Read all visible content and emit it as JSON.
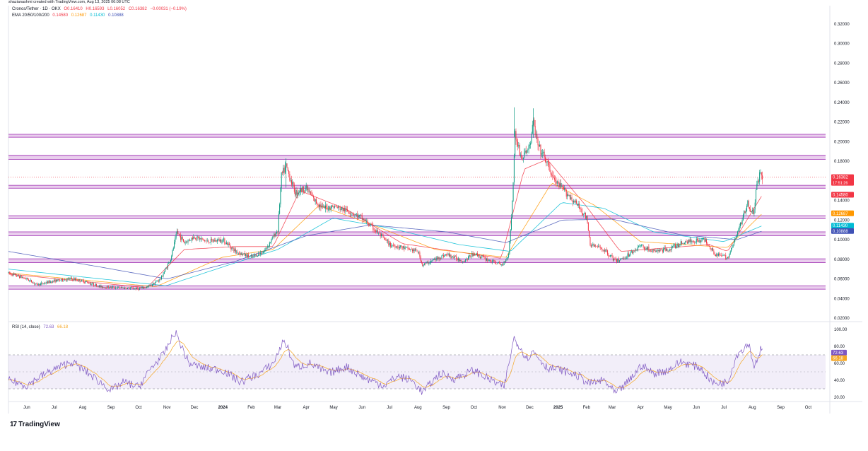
{
  "header": {
    "credit": "shazianashmi created with TradingView.com, Aug 13, 2025 06:08 UTC",
    "symbol": "Cronos/Tether · 1D · OKX",
    "o": "O0.16410",
    "h": "H0.16593",
    "l": "L0.16052",
    "c": "C0.16382",
    "chg": "−0.00031 (−0.19%)",
    "ema_label": "EMA 20/50/100/200",
    "ema_values": [
      "0.14580",
      "0.12687",
      "0.11430",
      "0.10888"
    ],
    "rsi_label": "RSI (14, close)",
    "rsi_values": [
      "72.63",
      "66.18"
    ]
  },
  "logo": {
    "mark": "17",
    "text": "TradingView"
  },
  "colors": {
    "up": "#089981",
    "down": "#f23645",
    "zone_fill": "#e1bee7",
    "zone_line": "#9c27b0",
    "ema20": "#f23645",
    "ema50": "#ff9800",
    "ema100": "#00bcd4",
    "ema200": "#3f51b5",
    "rsi": "#7e57c2",
    "rsi_ma": "#f5a623"
  },
  "chart_data": [
    {
      "type": "candlestick",
      "yaxis": {
        "min": 0.02,
        "max": 0.32,
        "ticks": [
          "0.32000",
          "0.30000",
          "0.28000",
          "0.26000",
          "0.24000",
          "0.22000",
          "0.20000",
          "0.18000",
          "0.16000",
          "0.14000",
          "0.12000",
          "0.10000",
          "0.08000",
          "0.06000",
          "0.04000",
          "0.02000"
        ]
      },
      "xaxis": {
        "labels": [
          "Jun",
          "Jul",
          "Aug",
          "Sep",
          "Oct",
          "Nov",
          "Dec",
          "2024",
          "Feb",
          "Mar",
          "Apr",
          "May",
          "Jun",
          "Jul",
          "Aug",
          "Sep",
          "Oct",
          "Nov",
          "Dec",
          "2025",
          "Feb",
          "Mar",
          "Apr",
          "May",
          "Jun",
          "Jul",
          "Aug",
          "Sep",
          "Oct"
        ]
      },
      "zones": [
        [
          0.2045,
          0.2075
        ],
        [
          0.182,
          0.186
        ],
        [
          0.1525,
          0.1555
        ],
        [
          0.1215,
          0.1245
        ],
        [
          0.104,
          0.108
        ],
        [
          0.0765,
          0.0805
        ],
        [
          0.0495,
          0.053
        ]
      ],
      "price_labels": [
        {
          "value": 0.16382,
          "text": "0.16382",
          "sub": "17:51:26",
          "color": "#f23645"
        },
        {
          "value": 0.1458,
          "text": "0.14580",
          "color": "#f23645"
        },
        {
          "value": 0.12687,
          "text": "0.12687",
          "color": "#ff9800"
        },
        {
          "value": 0.1143,
          "text": "0.11430",
          "color": "#00bcd4"
        },
        {
          "value": 0.10888,
          "text": "0.10888",
          "color": "#3f51b5"
        }
      ],
      "price_path": [
        [
          "2023-05-12",
          0.066
        ],
        [
          "2023-06-01",
          0.06
        ],
        [
          "2023-06-12",
          0.054
        ],
        [
          "2023-07-01",
          0.058
        ],
        [
          "2023-07-20",
          0.06
        ],
        [
          "2023-08-01",
          0.058
        ],
        [
          "2023-08-20",
          0.052
        ],
        [
          "2023-09-10",
          0.051
        ],
        [
          "2023-10-01",
          0.05
        ],
        [
          "2023-10-12",
          0.052
        ],
        [
          "2023-10-25",
          0.06
        ],
        [
          "2023-11-05",
          0.08
        ],
        [
          "2023-11-12",
          0.108
        ],
        [
          "2023-11-20",
          0.097
        ],
        [
          "2023-12-01",
          0.103
        ],
        [
          "2023-12-15",
          0.098
        ],
        [
          "2024-01-01",
          0.1
        ],
        [
          "2024-01-15",
          0.088
        ],
        [
          "2024-02-01",
          0.082
        ],
        [
          "2024-02-15",
          0.088
        ],
        [
          "2024-03-01",
          0.11
        ],
        [
          "2024-03-05",
          0.165
        ],
        [
          "2024-03-10",
          0.175
        ],
        [
          "2024-03-20",
          0.148
        ],
        [
          "2024-04-01",
          0.153
        ],
        [
          "2024-04-10",
          0.14
        ],
        [
          "2024-04-20",
          0.132
        ],
        [
          "2024-05-01",
          0.134
        ],
        [
          "2024-05-20",
          0.128
        ],
        [
          "2024-06-01",
          0.122
        ],
        [
          "2024-06-15",
          0.11
        ],
        [
          "2024-07-01",
          0.095
        ],
        [
          "2024-07-15",
          0.092
        ],
        [
          "2024-08-01",
          0.088
        ],
        [
          "2024-08-06",
          0.074
        ],
        [
          "2024-08-20",
          0.08
        ],
        [
          "2024-09-01",
          0.085
        ],
        [
          "2024-09-20",
          0.078
        ],
        [
          "2024-10-01",
          0.086
        ],
        [
          "2024-10-15",
          0.08
        ],
        [
          "2024-11-01",
          0.074
        ],
        [
          "2024-11-08",
          0.085
        ],
        [
          "2024-11-12",
          0.138
        ],
        [
          "2024-11-15",
          0.208
        ],
        [
          "2024-11-22",
          0.182
        ],
        [
          "2024-12-01",
          0.196
        ],
        [
          "2024-12-05",
          0.22
        ],
        [
          "2024-12-10",
          0.195
        ],
        [
          "2024-12-18",
          0.182
        ],
        [
          "2024-12-28",
          0.16
        ],
        [
          "2025-01-10",
          0.148
        ],
        [
          "2025-01-25",
          0.132
        ],
        [
          "2025-02-01",
          0.122
        ],
        [
          "2025-02-05",
          0.095
        ],
        [
          "2025-02-20",
          0.09
        ],
        [
          "2025-03-05",
          0.078
        ],
        [
          "2025-03-15",
          0.082
        ],
        [
          "2025-04-01",
          0.094
        ],
        [
          "2025-04-15",
          0.088
        ],
        [
          "2025-05-01",
          0.09
        ],
        [
          "2025-05-20",
          0.098
        ],
        [
          "2025-06-10",
          0.1
        ],
        [
          "2025-06-22",
          0.085
        ],
        [
          "2025-07-05",
          0.082
        ],
        [
          "2025-07-10",
          0.092
        ],
        [
          "2025-07-20",
          0.118
        ],
        [
          "2025-07-27",
          0.138
        ],
        [
          "2025-08-02",
          0.125
        ],
        [
          "2025-08-06",
          0.155
        ],
        [
          "2025-08-10",
          0.17
        ],
        [
          "2025-08-12",
          0.1638
        ]
      ],
      "ema_paths": {
        "ema20": [
          [
            "2023-05-12",
            0.065
          ],
          [
            "2023-10-10",
            0.051
          ],
          [
            "2023-11-20",
            0.09
          ],
          [
            "2024-01-15",
            0.093
          ],
          [
            "2024-02-25",
            0.093
          ],
          [
            "2024-03-25",
            0.15
          ],
          [
            "2024-05-15",
            0.131
          ],
          [
            "2024-07-15",
            0.096
          ],
          [
            "2024-10-31",
            0.081
          ],
          [
            "2024-11-25",
            0.172
          ],
          [
            "2024-12-20",
            0.182
          ],
          [
            "2025-01-31",
            0.135
          ],
          [
            "2025-03-10",
            0.088
          ],
          [
            "2025-06-15",
            0.095
          ],
          [
            "2025-07-05",
            0.088
          ],
          [
            "2025-08-12",
            0.1458
          ]
        ],
        "ema50": [
          [
            "2023-05-12",
            0.066
          ],
          [
            "2023-10-20",
            0.052
          ],
          [
            "2023-12-31",
            0.082
          ],
          [
            "2024-02-25",
            0.09
          ],
          [
            "2024-04-15",
            0.135
          ],
          [
            "2024-06-10",
            0.116
          ],
          [
            "2024-08-20",
            0.09
          ],
          [
            "2024-11-05",
            0.082
          ],
          [
            "2024-12-25",
            0.158
          ],
          [
            "2025-02-10",
            0.135
          ],
          [
            "2025-04-01",
            0.098
          ],
          [
            "2025-07-05",
            0.092
          ],
          [
            "2025-08-12",
            0.12687
          ]
        ],
        "ema100": [
          [
            "2023-05-12",
            0.07
          ],
          [
            "2023-10-31",
            0.053
          ],
          [
            "2024-01-10",
            0.075
          ],
          [
            "2024-03-01",
            0.09
          ],
          [
            "2024-04-30",
            0.122
          ],
          [
            "2024-06-30",
            0.112
          ],
          [
            "2024-09-15",
            0.095
          ],
          [
            "2024-11-10",
            0.088
          ],
          [
            "2025-01-05",
            0.138
          ],
          [
            "2025-02-20",
            0.132
          ],
          [
            "2025-04-15",
            0.108
          ],
          [
            "2025-07-01",
            0.098
          ],
          [
            "2025-08-12",
            0.1143
          ]
        ],
        "ema200": [
          [
            "2023-05-12",
            0.088
          ],
          [
            "2023-08-15",
            0.073
          ],
          [
            "2023-11-01",
            0.06
          ],
          [
            "2024-01-15",
            0.078
          ],
          [
            "2024-04-01",
            0.104
          ],
          [
            "2024-06-10",
            0.115
          ],
          [
            "2024-09-01",
            0.108
          ],
          [
            "2024-11-05",
            0.097
          ],
          [
            "2025-01-05",
            0.12
          ],
          [
            "2025-03-01",
            0.121
          ],
          [
            "2025-05-15",
            0.105
          ],
          [
            "2025-07-15",
            0.1
          ],
          [
            "2025-08-12",
            0.10888
          ]
        ]
      }
    },
    {
      "type": "line",
      "title": "RSI (14, close)",
      "yaxis": {
        "min": 20,
        "max": 100,
        "ticks": [
          "100.00",
          "80.00",
          "60.00",
          "40.00",
          "20.00"
        ]
      },
      "bands": {
        "upper": 70,
        "middle": 50,
        "lower": 30
      },
      "value_labels": [
        {
          "value": 72.63,
          "text": "72.63",
          "color": "#7e57c2"
        },
        {
          "value": 66.18,
          "text": "66.18",
          "color": "#f5a623"
        }
      ],
      "rsi_path": [
        [
          "2023-05-12",
          40
        ],
        [
          "2023-06-01",
          34
        ],
        [
          "2023-06-15",
          44
        ],
        [
          "2023-07-05",
          55
        ],
        [
          "2023-07-20",
          62
        ],
        [
          "2023-08-10",
          46
        ],
        [
          "2023-09-01",
          28
        ],
        [
          "2023-09-15",
          38
        ],
        [
          "2023-10-01",
          32
        ],
        [
          "2023-10-15",
          55
        ],
        [
          "2023-10-28",
          70
        ],
        [
          "2023-11-10",
          97
        ],
        [
          "2023-11-25",
          60
        ],
        [
          "2023-12-10",
          55
        ],
        [
          "2024-01-01",
          52
        ],
        [
          "2024-01-20",
          38
        ],
        [
          "2024-02-10",
          48
        ],
        [
          "2024-02-25",
          60
        ],
        [
          "2024-03-08",
          88
        ],
        [
          "2024-03-20",
          55
        ],
        [
          "2024-04-05",
          60
        ],
        [
          "2024-04-25",
          48
        ],
        [
          "2024-05-15",
          56
        ],
        [
          "2024-06-05",
          42
        ],
        [
          "2024-06-25",
          34
        ],
        [
          "2024-07-10",
          45
        ],
        [
          "2024-07-25",
          40
        ],
        [
          "2024-08-06",
          26
        ],
        [
          "2024-08-25",
          48
        ],
        [
          "2024-09-10",
          42
        ],
        [
          "2024-10-01",
          52
        ],
        [
          "2024-10-20",
          40
        ],
        [
          "2024-11-03",
          32
        ],
        [
          "2024-11-14",
          90
        ],
        [
          "2024-11-28",
          66
        ],
        [
          "2024-12-05",
          74
        ],
        [
          "2024-12-20",
          55
        ],
        [
          "2025-01-05",
          52
        ],
        [
          "2025-01-25",
          44
        ],
        [
          "2025-02-03",
          36
        ],
        [
          "2025-02-20",
          40
        ],
        [
          "2025-03-05",
          24
        ],
        [
          "2025-03-20",
          40
        ],
        [
          "2025-04-02",
          58
        ],
        [
          "2025-04-15",
          48
        ],
        [
          "2025-05-01",
          52
        ],
        [
          "2025-05-15",
          62
        ],
        [
          "2025-06-05",
          55
        ],
        [
          "2025-06-20",
          36
        ],
        [
          "2025-07-05",
          38
        ],
        [
          "2025-07-15",
          70
        ],
        [
          "2025-07-28",
          84
        ],
        [
          "2025-08-03",
          56
        ],
        [
          "2025-08-10",
          76
        ],
        [
          "2025-08-12",
          72.63
        ]
      ]
    }
  ]
}
